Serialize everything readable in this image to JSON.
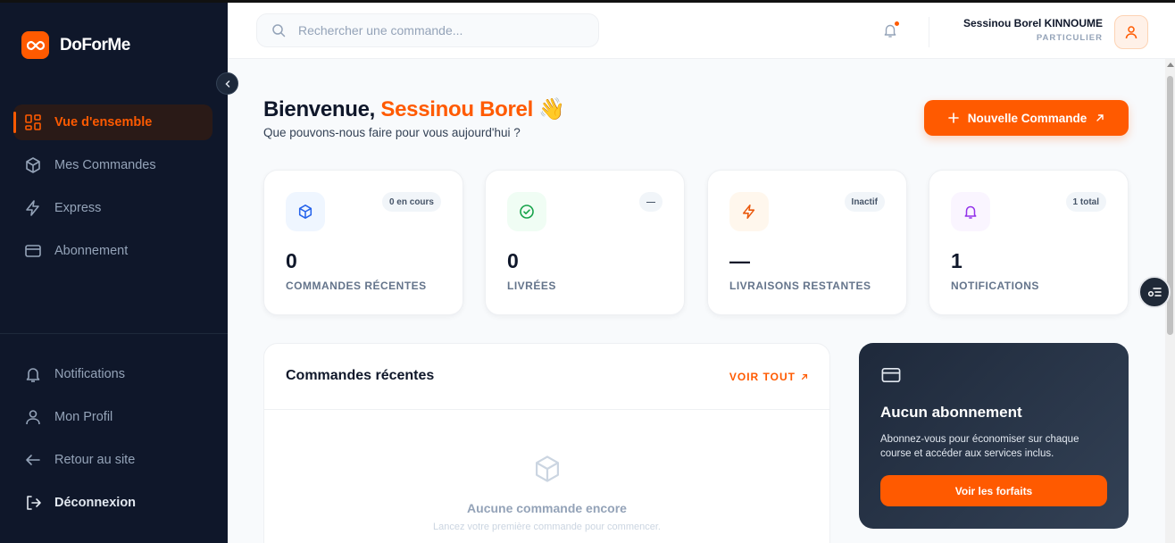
{
  "brand": {
    "name": "DoForMe"
  },
  "sidebar": {
    "nav": [
      {
        "label": "Vue d'ensemble",
        "icon": "dashboard-icon",
        "active": true
      },
      {
        "label": "Mes Commandes",
        "icon": "box-icon"
      },
      {
        "label": "Express",
        "icon": "lightning-icon"
      },
      {
        "label": "Abonnement",
        "icon": "credit-card-icon"
      }
    ],
    "bottom": [
      {
        "label": "Notifications",
        "icon": "bell-icon"
      },
      {
        "label": "Mon Profil",
        "icon": "user-icon"
      },
      {
        "label": "Retour au site",
        "icon": "arrow-left-icon"
      },
      {
        "label": "Déconnexion",
        "icon": "logout-icon"
      }
    ]
  },
  "topbar": {
    "search_placeholder": "Rechercher une commande...",
    "user_name": "Sessinou Borel KINNOUME",
    "user_role": "PARTICULIER"
  },
  "main": {
    "greeting_prefix": "Bienvenue, ",
    "greeting_name": "Sessinou Borel",
    "greeting_emoji": "👋",
    "subtitle": "Que pouvons-nous faire pour vous aujourd'hui ?",
    "new_order_label": "Nouvelle Commande"
  },
  "stats": [
    {
      "value": "0",
      "label": "COMMANDES RÉCENTES",
      "badge": "0 en cours",
      "icon": "box-icon",
      "color": "#2563eb",
      "bg": "#eff6ff"
    },
    {
      "value": "0",
      "label": "LIVRÉES",
      "badge": "—",
      "icon": "check-circle-icon",
      "color": "#16a34a",
      "bg": "#f0fdf4"
    },
    {
      "value": "—",
      "label": "LIVRAISONS RESTANTES",
      "badge": "Inactif",
      "icon": "lightning-icon",
      "color": "#ea580c",
      "bg": "#fff7ed"
    },
    {
      "value": "1",
      "label": "NOTIFICATIONS",
      "badge": "1 total",
      "icon": "bell-icon",
      "color": "#9333ea",
      "bg": "#faf5ff"
    }
  ],
  "recent": {
    "title": "Commandes récentes",
    "see_all": "VOIR TOUT",
    "empty_title": "Aucune commande encore",
    "empty_subtitle": "Lancez votre première commande pour commencer."
  },
  "subscription": {
    "title": "Aucun abonnement",
    "text": "Abonnez-vous pour économiser sur chaque course et accéder aux services inclus.",
    "button": "Voir les forfaits"
  },
  "colors": {
    "accent": "#ff5a00",
    "sidebar": "#0f172a"
  }
}
